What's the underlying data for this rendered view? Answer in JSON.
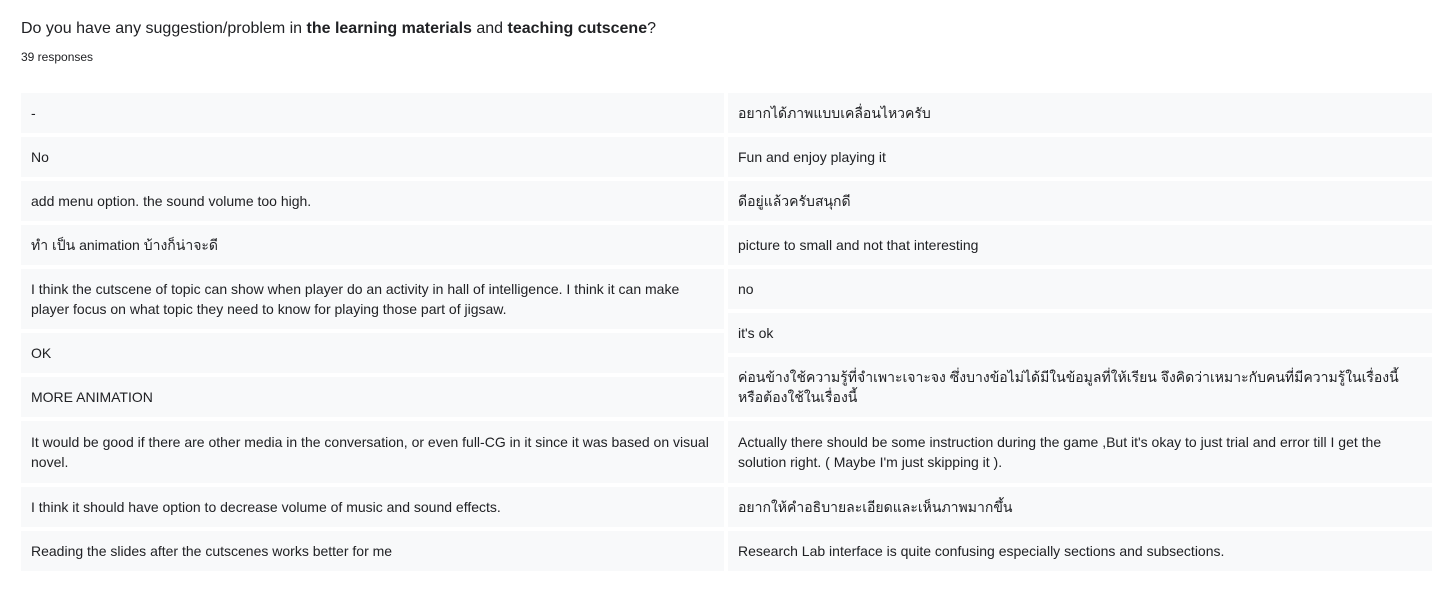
{
  "question": {
    "prefix": "Do you have any suggestion/problem in ",
    "bold1": "the learning materials",
    "middle": " and ",
    "bold2": "teaching cutscene",
    "suffix": "?"
  },
  "response_count": "39 responses",
  "left_responses": [
    "-",
    "No",
    "add menu option. the sound volume too high.",
    "ทำ เป็น animation บ้างก็น่าจะดี",
    "I think the cutscene of topic can show when player do an activity in hall of intelligence. I think it can make player focus on what topic they need to know for playing those part of jigsaw.",
    "OK",
    "MORE ANIMATION",
    "It would be good if there are other media in the conversation, or even full-CG in it since it was based on visual novel.",
    "I think it should have option to decrease volume of music and sound effects.",
    "Reading the slides after the cutscenes works better for me"
  ],
  "right_responses": [
    "อยากได้ภาพแบบเคลื่อนไหวครับ",
    "Fun and enjoy playing it",
    "ดีอยู่แล้วครับสนุกดี",
    "picture to small and not that interesting",
    "no",
    "it's ok",
    "ค่อนข้างใช้ความรู้ที่จำเพาะเจาะจง ซึ่งบางข้อไม่ได้มีในข้อมูลที่ให้เรียน จึงคิดว่าเหมาะกับคนที่มีความรู้ในเรื่องนี้หรือต้องใช้ในเรื่องนี้",
    "Actually there should be some instruction during the game ,But it's okay to just trial and error till I get the solution right. ( Maybe I'm just skipping it ).",
    "อยากให้คำอธิบายละเอียดและเห็นภาพมากขึ้น",
    "Research Lab interface is quite confusing especially sections and subsections."
  ]
}
